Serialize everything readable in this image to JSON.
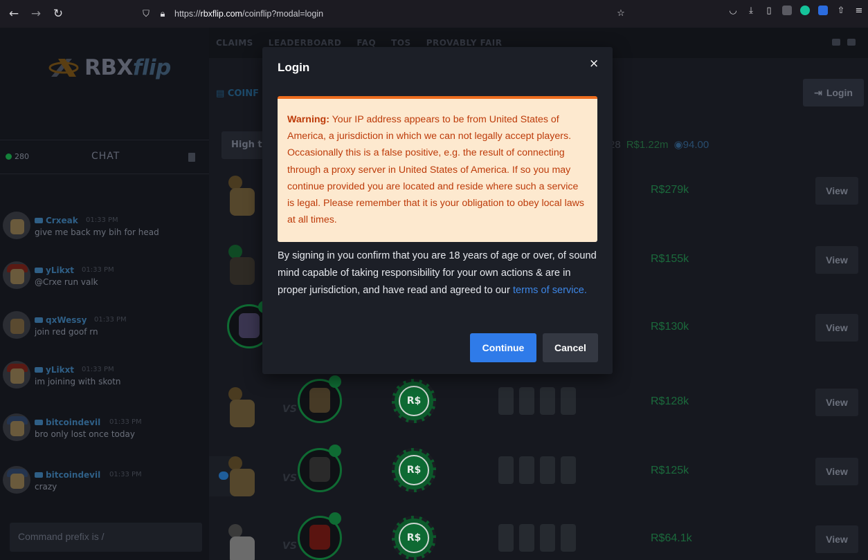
{
  "browser": {
    "url_prefix": "https://",
    "url_domain": "rbxflip.com",
    "url_path": "/coinflip?modal=login"
  },
  "site": {
    "logo_main": "RBX",
    "logo_accent": "flip",
    "nav": [
      "CLAIMS",
      "LEADERBOARD",
      "FAQ",
      "TOS",
      "PROVABLY FAIR"
    ],
    "coinflip_tab": "COINF",
    "login_label": "Login",
    "filter_label": "High t",
    "stats": {
      "count": "28",
      "total": "R$1.22m",
      "coins": "94.00"
    }
  },
  "chat": {
    "online_count": "280",
    "title": "CHAT",
    "command_placeholder": "Command prefix is /",
    "messages": [
      {
        "user": "Crxeak",
        "time": "01:33 PM",
        "text": "give me back my bih for head"
      },
      {
        "user": "yLikxt",
        "time": "01:33 PM",
        "text": "@Crxe run valk"
      },
      {
        "user": "qxWessy",
        "time": "01:33 PM",
        "text": "join red goof rn"
      },
      {
        "user": "yLikxt",
        "time": "01:33 PM",
        "text": "im joining with skotn"
      },
      {
        "user": "bitcoindevil",
        "time": "01:33 PM",
        "text": "bro only lost once today"
      },
      {
        "user": "bitcoindevil",
        "time": "01:33 PM",
        "text": "crazy"
      }
    ]
  },
  "games": [
    {
      "value": "R$279k",
      "view": "View"
    },
    {
      "value": "R$155k",
      "view": "View"
    },
    {
      "value": "R$130k",
      "view": "View"
    },
    {
      "value": "R$128k",
      "view": "View"
    },
    {
      "value": "R$125k",
      "view": "View"
    },
    {
      "value": "R$64.1k",
      "view": "View"
    }
  ],
  "chip_label": "R$",
  "vs_label": "VS",
  "modal": {
    "title": "Login",
    "close": "×",
    "warning_label": "Warning:",
    "warning_text": "Your IP address appears to be from United States of America, a jurisdiction in which we can not legally accept players. Occasionally this is a false positive, e.g. the result of connecting through a proxy server in United States of America. If so you may continue provided you are located and reside where such a service is legal. Please remember that it is your obligation to obey local laws at all times.",
    "body_text": "By signing in you confirm that you are 18 years of age or over, of sound mind capable of taking responsibility for your own actions & are in proper jurisdiction, and have read and agreed to our ",
    "tos_link": "terms of service.",
    "continue": "Continue",
    "cancel": "Cancel"
  },
  "colors": {
    "accent": "#2f7be9",
    "warning_bg": "#fde9cf",
    "warning_text": "#bd3b0a",
    "warning_border": "#ee6d1e"
  }
}
